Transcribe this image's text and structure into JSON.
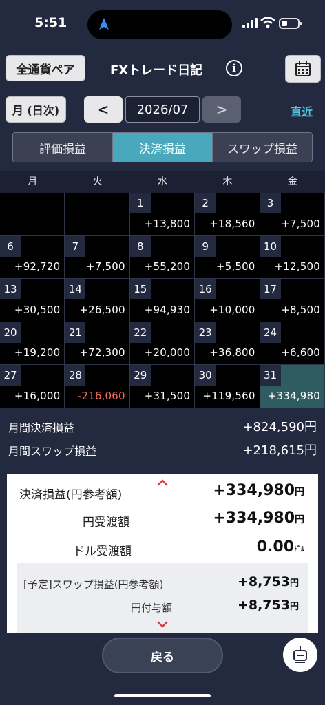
{
  "status": {
    "time": "5:51"
  },
  "header": {
    "pair_button": "全通貨ペア",
    "title": "FXトレード日記",
    "info_icon": "i",
    "calendar_icon": "calendar-icon"
  },
  "nav": {
    "period_button": "月 (日次)",
    "prev": "<",
    "date": "2026/07",
    "next": ">",
    "recent": "直近"
  },
  "tabs": [
    {
      "label": "評価損益",
      "active": false
    },
    {
      "label": "決済損益",
      "active": true
    },
    {
      "label": "スワップ損益",
      "active": false
    }
  ],
  "weekdays": [
    "月",
    "火",
    "水",
    "木",
    "金"
  ],
  "calendar": [
    {
      "day": "",
      "value": ""
    },
    {
      "day": "",
      "value": ""
    },
    {
      "day": "1",
      "value": "+13,800"
    },
    {
      "day": "2",
      "value": "+18,560"
    },
    {
      "day": "3",
      "value": "+7,500"
    },
    {
      "day": "6",
      "value": "+92,720"
    },
    {
      "day": "7",
      "value": "+7,500"
    },
    {
      "day": "8",
      "value": "+55,200"
    },
    {
      "day": "9",
      "value": "+5,500"
    },
    {
      "day": "10",
      "value": "+12,500"
    },
    {
      "day": "13",
      "value": "+30,500"
    },
    {
      "day": "14",
      "value": "+26,500"
    },
    {
      "day": "15",
      "value": "+94,930"
    },
    {
      "day": "16",
      "value": "+10,000"
    },
    {
      "day": "17",
      "value": "+8,500"
    },
    {
      "day": "20",
      "value": "+19,200"
    },
    {
      "day": "21",
      "value": "+72,300"
    },
    {
      "day": "22",
      "value": "+20,000"
    },
    {
      "day": "23",
      "value": "+36,800"
    },
    {
      "day": "24",
      "value": "+6,600"
    },
    {
      "day": "27",
      "value": "+16,000"
    },
    {
      "day": "28",
      "value": "-216,060",
      "negative": true
    },
    {
      "day": "29",
      "value": "+31,500"
    },
    {
      "day": "30",
      "value": "+119,560"
    },
    {
      "day": "31",
      "value": "+334,980",
      "selected": true
    }
  ],
  "summary": {
    "monthly_settlement_label": "月間決済損益",
    "monthly_settlement_value": "+824,590円",
    "monthly_swap_label": "月間スワップ損益",
    "monthly_swap_value": "+218,615円"
  },
  "detail": {
    "settlement_label": "決済損益(円参考額)",
    "settlement_value": "+334,980",
    "settlement_unit": "円",
    "yen_transfer_label": "円受渡額",
    "yen_transfer_value": "+334,980",
    "yen_transfer_unit": "円",
    "dollar_transfer_label": "ドル受渡額",
    "dollar_transfer_value": "0.00",
    "dollar_transfer_unit": "ﾄﾞﾙ",
    "swap_label": "[予定]スワップ損益(円参考額)",
    "swap_value": "+8,753",
    "swap_unit": "円",
    "yen_grant_label": "円付与額",
    "yen_grant_value": "+8,753",
    "yen_grant_unit": "円"
  },
  "bottom": {
    "back_button": "戻る",
    "fab_icon": "chat-icon"
  },
  "colors": {
    "background": "#232a3f",
    "accent": "#4aa8bd",
    "link": "#4fc3dc",
    "negative": "#f26b5b",
    "selected_cell": "#2f5c61"
  }
}
